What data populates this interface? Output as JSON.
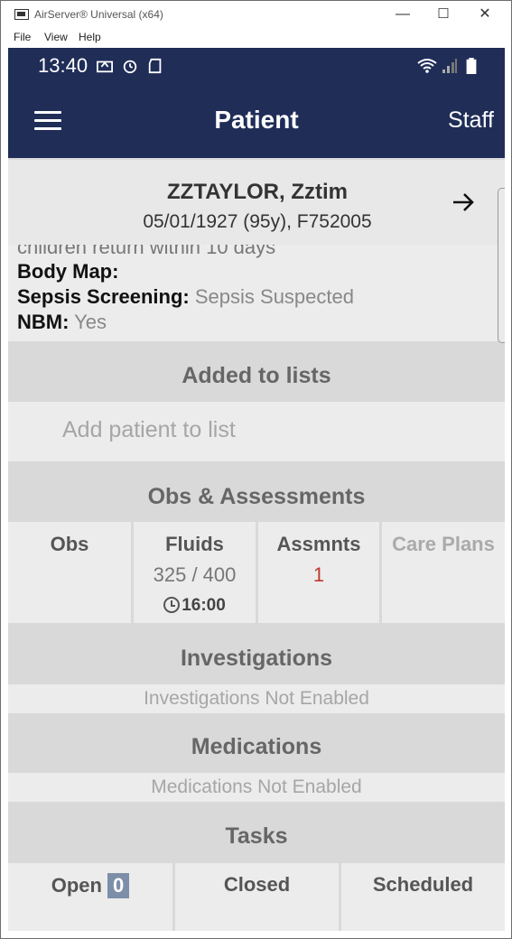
{
  "window": {
    "title": "AirServer® Universal (x64)",
    "minimize": "—",
    "maximize": "☐",
    "close": "✕"
  },
  "menu": [
    "File",
    "View",
    "Help"
  ],
  "status_bar": {
    "time": "13:40"
  },
  "app_bar": {
    "title": "Patient",
    "staff_label": "Staff"
  },
  "patient": {
    "name": "ZZTAYLOR, Zztim",
    "dob_line": "05/01/1927 (95y), F752005"
  },
  "details": {
    "cut_text": "children return within 10 days",
    "rows": [
      {
        "label": "Body Map:",
        "value": ""
      },
      {
        "label": "Sepsis Screening:",
        "value": "Sepsis Suspected"
      },
      {
        "label": "NBM:",
        "value": "Yes"
      }
    ]
  },
  "lists": {
    "header": "Added to lists",
    "add_placeholder": "Add patient to list"
  },
  "obs": {
    "header": "Obs & Assessments",
    "tiles": [
      {
        "label": "Obs",
        "value": "",
        "time": ""
      },
      {
        "label": "Fluids",
        "value": "325 / 400",
        "time": "16:00"
      },
      {
        "label": "Assmnts",
        "value": "1",
        "time": ""
      },
      {
        "label": "Care Plans",
        "value": "",
        "time": ""
      }
    ]
  },
  "investigations": {
    "header": "Investigations",
    "status": "Investigations Not Enabled"
  },
  "medications": {
    "header": "Medications",
    "status": "Medications Not Enabled"
  },
  "tasks": {
    "header": "Tasks",
    "open_label": "Open",
    "open_count": "0",
    "closed_label": "Closed",
    "scheduled_label": "Scheduled"
  }
}
